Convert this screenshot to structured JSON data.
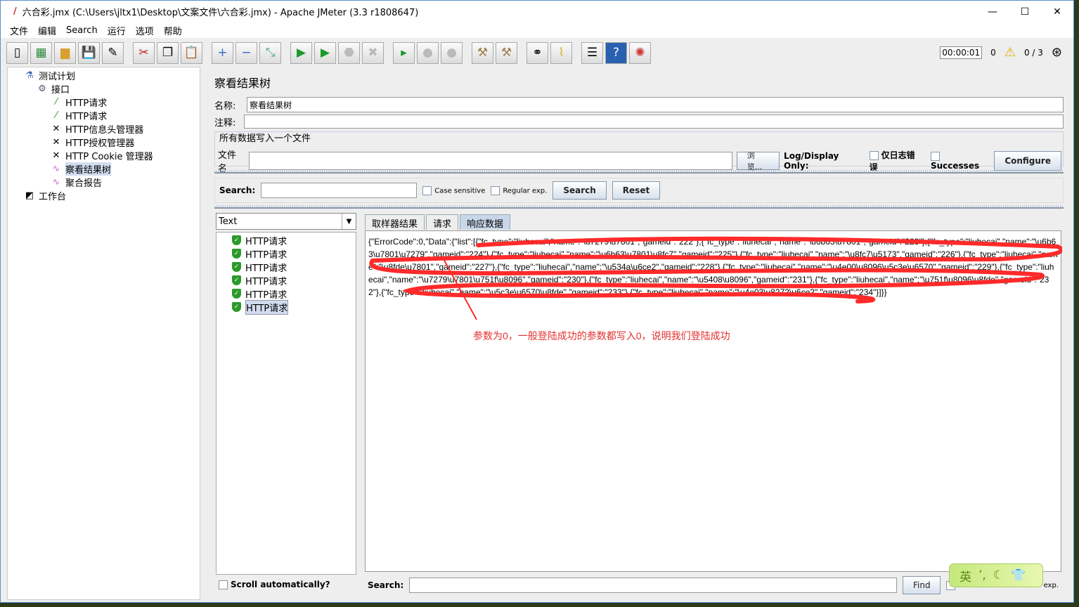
{
  "window": {
    "title": "六合彩.jmx (C:\\Users\\jltx1\\Desktop\\文案文件\\六合彩.jmx) - Apache JMeter (3.3 r1808647)"
  },
  "menu": [
    "文件",
    "编辑",
    "Search",
    "运行",
    "选项",
    "帮助"
  ],
  "toolbar": {
    "timer": "00:00:01",
    "warnings": "0",
    "threads": "0 / 3"
  },
  "tree": [
    {
      "label": "测试计划",
      "icon": "test-plan-icon"
    },
    {
      "label": "接口",
      "icon": "gear-icon"
    },
    {
      "label": "HTTP请求",
      "icon": "sampler-icon"
    },
    {
      "label": "HTTP请求",
      "icon": "sampler-icon"
    },
    {
      "label": "HTTP信息头管理器",
      "icon": "config-icon"
    },
    {
      "label": "HTTP授权管理器",
      "icon": "config-icon"
    },
    {
      "label": "HTTP Cookie 管理器",
      "icon": "config-icon"
    },
    {
      "label": "察看结果树",
      "icon": "listener-icon"
    },
    {
      "label": "聚合报告",
      "icon": "listener-icon"
    },
    {
      "label": "工作台",
      "icon": "workbench-icon"
    }
  ],
  "panel": {
    "title": "察看结果树",
    "name_label": "名称:",
    "name_value": "察看结果树",
    "comment_label": "注释:",
    "file_group": "所有数据写入一个文件",
    "file_label": "文件名",
    "browse": "浏览...",
    "log_only": "Log/Display Only:",
    "errors_only": "仅日志错误",
    "successes": "Successes",
    "configure": "Configure",
    "search_label": "Search:",
    "case_sensitive": "Case sensitive",
    "regex": "Regular exp.",
    "search_btn": "Search",
    "reset_btn": "Reset"
  },
  "renderer": "Text",
  "results": [
    "HTTP请求",
    "HTTP请求",
    "HTTP请求",
    "HTTP请求",
    "HTTP请求",
    "HTTP请求"
  ],
  "scroll_auto": "Scroll automatically?",
  "tabs": [
    "取样器结果",
    "请求",
    "响应数据"
  ],
  "response": "{\"ErrorCode\":0,\"Data\":{\"list\":[{\"fc_type\":\"liuhecai\",\"name\":\"\\u7279\\u7801\",\"gameid\":\"222\"},{\"fc_type\":\"liuhecai\",\"name\":\"\\u6b63\\u7801\",\"gameid\":\"223\"},{\"fc_type\":\"liuhecai\",\"name\":\"\\u6b63\\u7801\\u7279\",\"gameid\":\"224\"},{\"fc_type\":\"liuhecai\",\"name\":\"\\u6b63\\u7801\\u8fc7\",\"gameid\":\"225\"},{\"fc_type\":\"liuhecai\",\"name\":\"\\u8fc7\\u5173\",\"gameid\":\"226\"},{\"fc_type\":\"liuhecai\",\"name\":\"\\u8fde\\u7801\",\"gameid\":\"227\"},{\"fc_type\":\"liuhecai\",\"name\":\"\\u534a\\u6ce2\",\"gameid\":\"228\"},{\"fc_type\":\"liuhecai\",\"name\":\"\\u4e00\\u8096\\u5c3e\\u6570\",\"gameid\":\"229\"},{\"fc_type\":\"liuhecai\",\"name\":\"\\u7279\\u7801\\u751f\\u8096\",\"gameid\":\"230\"},{\"fc_type\":\"liuhecai\",\"name\":\"\\u5408\\u8096\",\"gameid\":\"231\"},{\"fc_type\":\"liuhecai\",\"name\":\"\\u751f\\u8096\\u8fde\",\"gameid\":\"232\"},{\"fc_type\":\"liuhecai\",\"name\":\"\\u5c3e\\u6570\\u8fde\",\"gameid\":\"233\"},{\"fc_type\":\"liuhecai\",\"name\":\"\\u4e03\\u8272\\u6ce2\",\"gameid\":\"234\"}]}}",
  "annotation": "参数为0，一般登陆成功的参数都写入0，说明我们登陆成功",
  "bottom_search": {
    "label": "Search:",
    "find": "Find",
    "regex_tail": "exp."
  },
  "ime": {
    "label": "英"
  },
  "colors": {
    "annotation": "#e53030",
    "selected": "#d2dcf0",
    "tab_active": "#c9d7ea"
  }
}
